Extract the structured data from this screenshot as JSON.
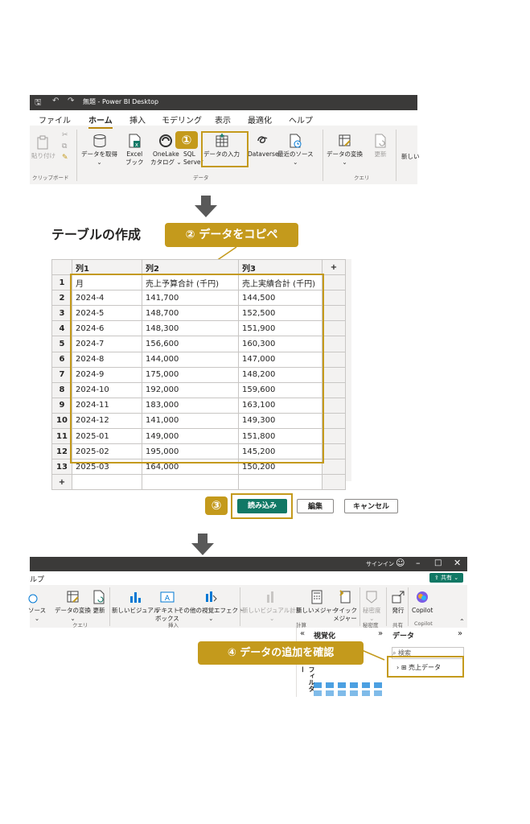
{
  "window": {
    "title": "無題 - Power BI Desktop",
    "tabs": [
      "ファイル",
      "ホーム",
      "挿入",
      "モデリング",
      "表示",
      "最適化",
      "ヘルプ"
    ],
    "active_tab": "ホーム"
  },
  "ribbon_home": {
    "paste": "貼り付け",
    "get_data": "データを取得",
    "excel": [
      "Excel",
      "ブック"
    ],
    "onelake": [
      "OneLake",
      "カタログ ⌄"
    ],
    "sql": [
      "SQL",
      "Server"
    ],
    "enter_data": "データの入力",
    "dataverse": "Dataverse",
    "recent_sources": "最近のソース",
    "transform": "データの変換",
    "refresh": "更新",
    "new_visual_partial": "新しい",
    "groups": {
      "clipboard": "クリップボード",
      "data": "データ",
      "query": "クエリ"
    }
  },
  "callouts": {
    "step1": "①",
    "step2": "② データをコピペ",
    "step3": "③",
    "step4": "④ データの追加を確認"
  },
  "create_table": {
    "heading": "テーブルの作成",
    "add_col": "+",
    "add_row": "+",
    "columns": [
      "列1",
      "列2",
      "列3"
    ],
    "rows": [
      [
        "1",
        "月",
        "売上予算合計 (千円)",
        "売上実績合計 (千円)"
      ],
      [
        "2",
        "2024-4",
        "141,700",
        "144,500"
      ],
      [
        "3",
        "2024-5",
        "148,700",
        "152,500"
      ],
      [
        "4",
        "2024-6",
        "148,300",
        "151,900"
      ],
      [
        "5",
        "2024-7",
        "156,600",
        "160,300"
      ],
      [
        "6",
        "2024-8",
        "144,000",
        "147,000"
      ],
      [
        "7",
        "2024-9",
        "175,000",
        "148,200"
      ],
      [
        "8",
        "2024-10",
        "192,000",
        "159,600"
      ],
      [
        "9",
        "2024-11",
        "183,000",
        "163,100"
      ],
      [
        "10",
        "2024-12",
        "141,000",
        "149,300"
      ],
      [
        "11",
        "2025-01",
        "149,000",
        "151,800"
      ],
      [
        "12",
        "2025-02",
        "195,000",
        "145,200"
      ],
      [
        "13",
        "2025-03",
        "164,000",
        "150,200"
      ]
    ],
    "btn_load": "読み込み",
    "btn_edit": "編集",
    "btn_cancel": "キャンセル"
  },
  "ribbon2": {
    "help_partial": "ルプ",
    "signin": "サインイン",
    "share": "共有",
    "recent_sources_partial": "ソース",
    "transform": "データの変換",
    "refresh": "更新",
    "new_visual": "新しいビジュアル",
    "textbox": [
      "テキスト",
      "ボックス"
    ],
    "more_visuals": "その他の視覚エフェクト",
    "new_visual_calc": "新しいビジュアル計算",
    "new_measure": "新しいメジャー",
    "quick_measure": [
      "クイック",
      "メジャー"
    ],
    "sensitivity": "秘密度",
    "publish": "発行",
    "copilot": "Copilot",
    "groups": {
      "query": "クエリ",
      "insert": "挿入",
      "calc": "計算",
      "sensitivity": "秘密度",
      "share": "共有",
      "copilot": "Copilot"
    }
  },
  "panes": {
    "viz_title": "視覚化",
    "data_title": "データ",
    "filter_label": "フィルター",
    "search_placeholder": "検索",
    "table_name": "売上データ"
  },
  "colors": {
    "accent": "#c49a1c",
    "load_button": "#117865",
    "titlebar": "#3b3a39"
  }
}
